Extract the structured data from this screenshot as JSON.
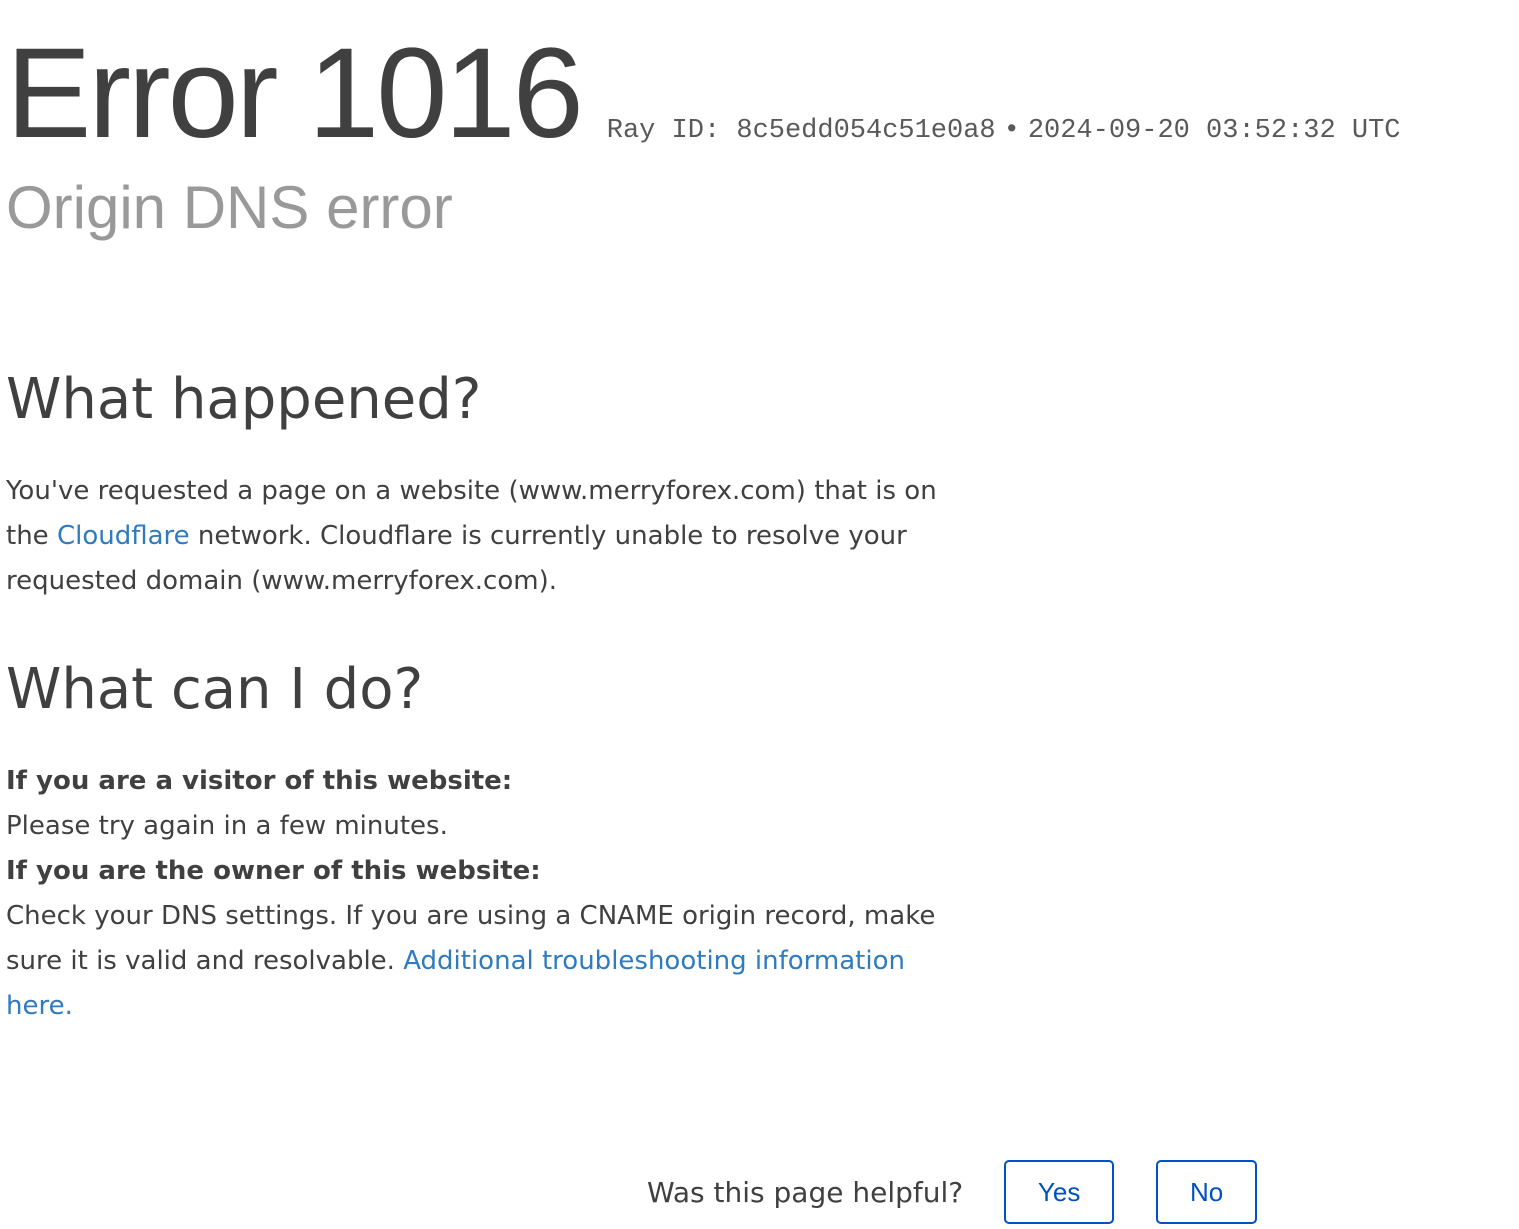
{
  "header": {
    "error_title": "Error 1016",
    "ray_label": "Ray ID:",
    "ray_id": "8c5edd054c51e0a8",
    "separator": "•",
    "timestamp": "2024-09-20 03:52:32 UTC",
    "subtitle": "Origin DNS error"
  },
  "what_happened": {
    "heading": "What happened?",
    "text_before_link": "You've requested a page on a website (www.merryforex.com) that is on the ",
    "link_text": "Cloudflare",
    "text_after_link": " network. Cloudflare is currently unable to resolve your requested domain (www.merryforex.com)."
  },
  "what_can_i_do": {
    "heading": "What can I do?",
    "visitor_label": "If you are a visitor of this website:",
    "visitor_text": "Please try again in a few minutes.",
    "owner_label": "If you are the owner of this website:",
    "owner_text": "Check your DNS settings. If you are using a CNAME origin record, make sure it is valid and resolvable. ",
    "owner_link": "Additional troubleshooting information here."
  },
  "feedback": {
    "question": "Was this page helpful?",
    "yes_label": "Yes",
    "no_label": "No"
  }
}
